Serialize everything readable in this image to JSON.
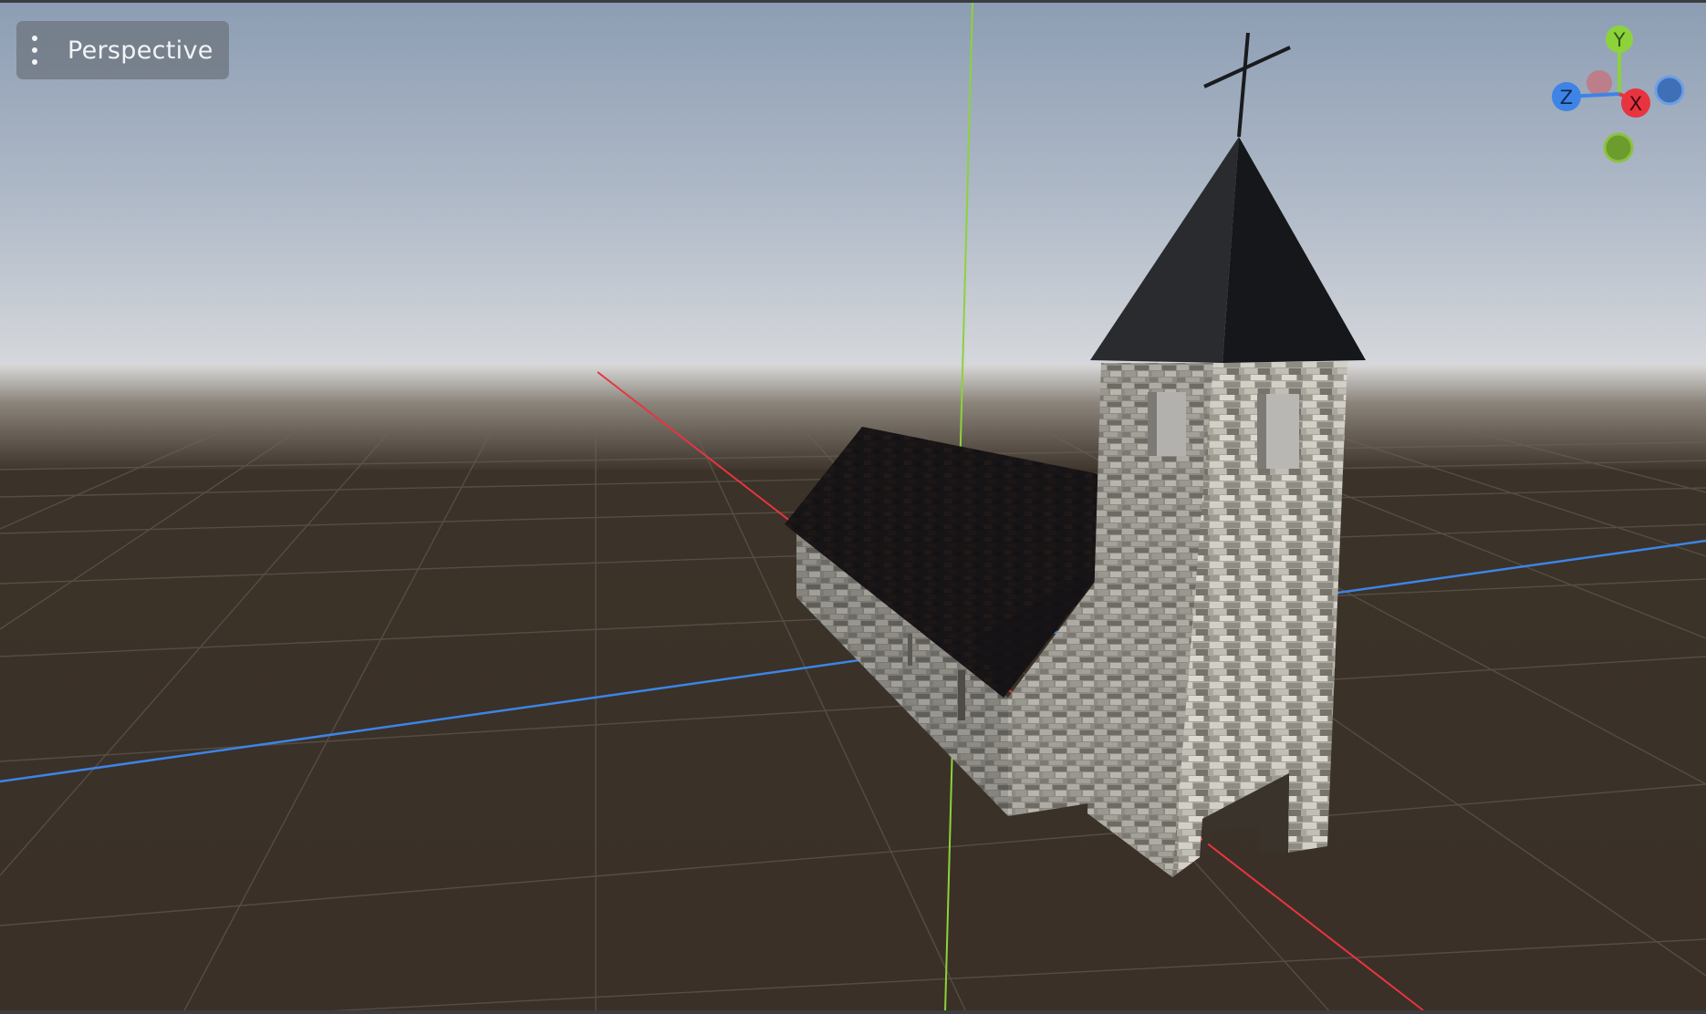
{
  "viewport": {
    "view_menu_label": "Perspective"
  },
  "gizmo": {
    "y_label": "Y",
    "z_label": "Z",
    "x_label": "X"
  },
  "colors": {
    "x_axis": "#e8343f",
    "y_axis": "#8cd23a",
    "z_axis": "#3d84e6",
    "ground": "#3a3128",
    "sky_top": "#8fa1b7",
    "roof": "#16171a",
    "stone": "#b9b6ad"
  },
  "icons": {
    "view_menu": "kebab-menu-icon"
  }
}
